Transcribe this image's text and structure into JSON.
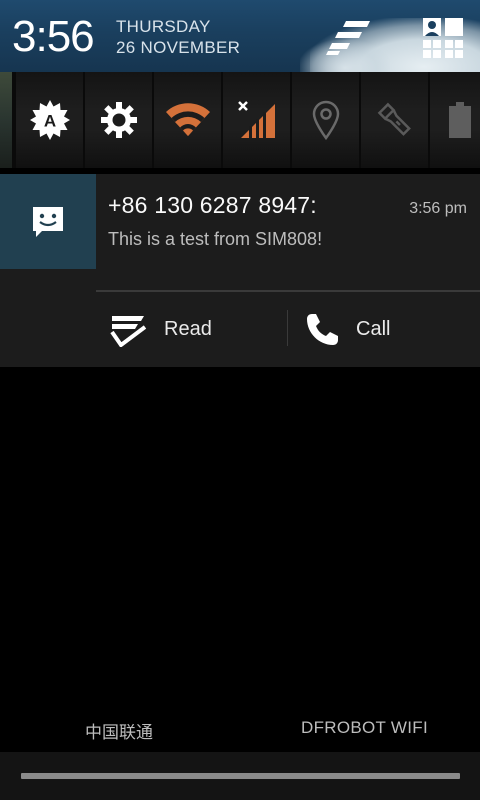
{
  "header": {
    "time": "3:56",
    "day": "THURSDAY",
    "date": "26 NOVEMBER",
    "icons": [
      "notification-settings-icon",
      "quick-settings-grid-icon"
    ]
  },
  "quick_settings": {
    "tiles": [
      {
        "icon": "auto-brightness-icon",
        "label": "A"
      },
      {
        "icon": "settings-gear-icon"
      },
      {
        "icon": "wifi-icon",
        "color": "#d4713a"
      },
      {
        "icon": "mobile-signal-icon",
        "color": "#d4713a"
      },
      {
        "icon": "location-icon"
      },
      {
        "icon": "flashlight-icon"
      },
      {
        "icon": "battery-icon"
      }
    ]
  },
  "notification": {
    "icon": "message-bubble-icon",
    "title": "+86 130 6287 8947:",
    "time": "3:56 pm",
    "text": "This is a test from SIM808!",
    "actions": [
      {
        "icon": "read-icon",
        "label": "Read"
      },
      {
        "icon": "phone-icon",
        "label": "Call"
      }
    ]
  },
  "footer": {
    "carrier": "中国联通",
    "wifi": "DFROBOT WIFI"
  },
  "colors": {
    "accent_orange": "#d4713a",
    "notification_icon_bg": "#214050"
  }
}
